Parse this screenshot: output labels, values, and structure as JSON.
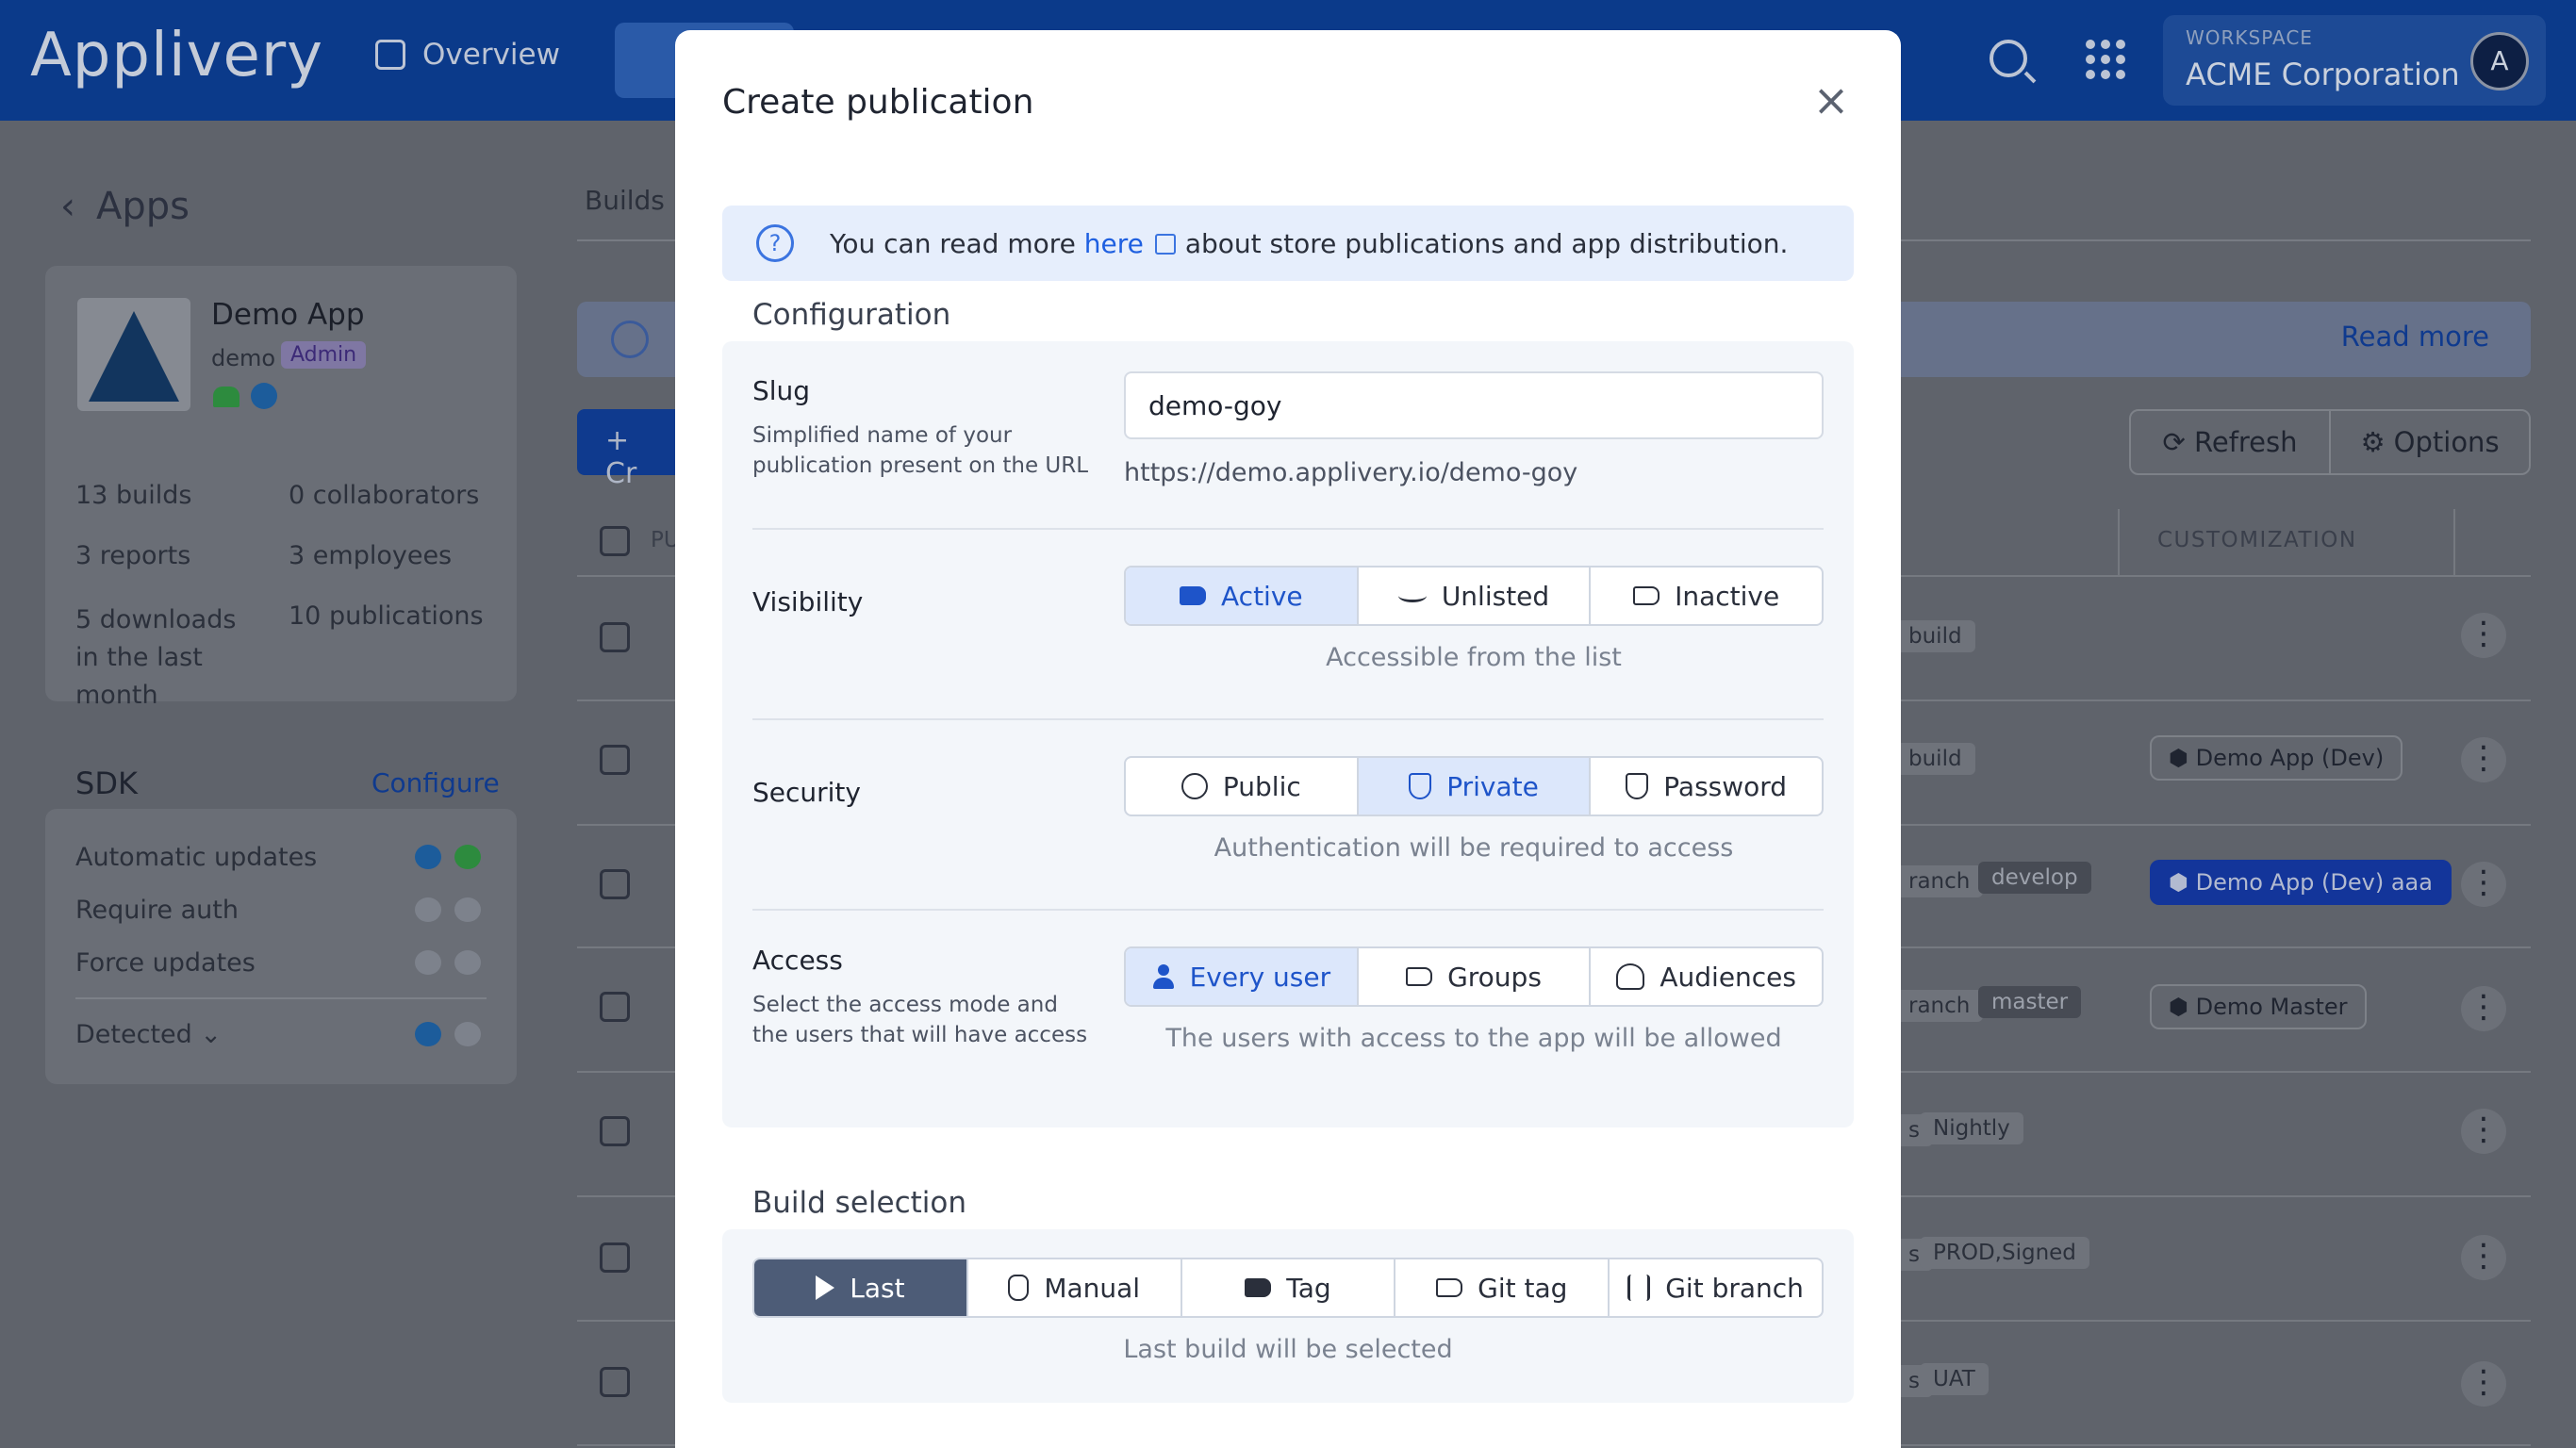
{
  "topbar": {
    "logo": "Applivery",
    "nav_overview": "Overview",
    "workspace_label": "WORKSPACE",
    "workspace_name": "ACME Corporation",
    "avatar_letter": "A"
  },
  "sidebar": {
    "back_label": "Apps",
    "app_name": "Demo App",
    "app_slug": "demo",
    "app_role": "Admin",
    "stats": [
      {
        "value": "13",
        "label": "builds"
      },
      {
        "value": "0",
        "label": "collaborators"
      },
      {
        "value": "3",
        "label": "reports"
      },
      {
        "value": "3",
        "label": "employees"
      },
      {
        "value": "5",
        "label": "downloads in the last month"
      },
      {
        "value": "10",
        "label": "publications"
      }
    ],
    "sdk_title": "SDK",
    "sdk_configure": "Configure",
    "sdk_rows": [
      "Automatic updates",
      "Require auth",
      "Force updates",
      "Detected"
    ]
  },
  "main": {
    "tab_builds": "Builds",
    "read_more": "Read more",
    "create_label": "+ Cr",
    "refresh": "Refresh",
    "options": "Options",
    "col_pu": "PU",
    "col_customization": "CUSTOMIZATION",
    "rows": [
      {
        "tag1": "build",
        "tag2": "",
        "pill": ""
      },
      {
        "tag1": "build",
        "tag2": "",
        "pill": "Demo App (Dev)"
      },
      {
        "tag1": "ranch",
        "tag2": "develop",
        "pill": "Demo App (Dev) aaa"
      },
      {
        "tag1": "ranch",
        "tag2": "master",
        "pill": "Demo Master"
      },
      {
        "tag1": "s",
        "tag2": "Nightly",
        "pill": ""
      },
      {
        "tag1": "s",
        "tag2": "PROD,Signed",
        "pill": ""
      },
      {
        "tag1": "s",
        "tag2": "UAT",
        "pill": ""
      }
    ]
  },
  "modal": {
    "title": "Create publication",
    "banner_before": "You can read more ",
    "banner_link": "here",
    "banner_after": "about store publications and app distribution.",
    "config_title": "Configuration",
    "slug_label": "Slug",
    "slug_desc": "Simplified name of your publication present on the URL",
    "slug_value": "demo-goy",
    "slug_url": "https://demo.applivery.io/demo-goy",
    "visibility_label": "Visibility",
    "visibility_options": [
      "Active",
      "Unlisted",
      "Inactive"
    ],
    "visibility_selected": "Active",
    "visibility_hint": "Accessible from the list",
    "security_label": "Security",
    "security_options": [
      "Public",
      "Private",
      "Password"
    ],
    "security_selected": "Private",
    "security_hint": "Authentication will be required to access",
    "access_label": "Access",
    "access_desc": "Select the access mode and the users that will have access",
    "access_options": [
      "Every user",
      "Groups",
      "Audiences"
    ],
    "access_selected": "Every user",
    "access_hint": "The users with access to the app will be allowed",
    "build_title": "Build selection",
    "build_options": [
      "Last",
      "Manual",
      "Tag",
      "Git tag",
      "Git branch"
    ],
    "build_selected": "Last",
    "build_hint": "Last build will be selected"
  }
}
